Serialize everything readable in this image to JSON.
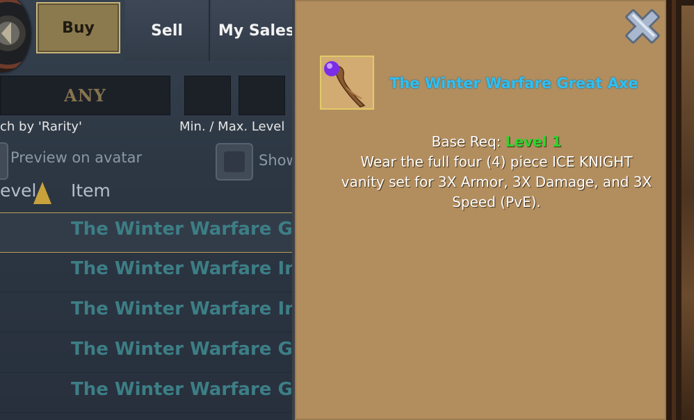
{
  "tabs": [
    {
      "label": "Buy",
      "active": true
    },
    {
      "label": "Sell",
      "active": false
    },
    {
      "label": "My Sales",
      "active": false
    }
  ],
  "filters": {
    "rarity_value": "ANY",
    "rarity_caption": "ch by 'Rarity'",
    "level_caption": "Min. / Max. Level"
  },
  "checkboxes": {
    "preview_label": "Preview on avatar",
    "show_label": "Show"
  },
  "columns": {
    "level": "evel",
    "item": "Item"
  },
  "rows": [
    {
      "name": "The Winter Warfare Great"
    },
    {
      "name": "The Winter Warfare Infan"
    },
    {
      "name": "The Winter Warfare Infan"
    },
    {
      "name": "The Winter Warfare Great"
    },
    {
      "name": "The Winter Warfare Great"
    }
  ],
  "tooltip": {
    "title": "The Winter Warfare Great Axe",
    "base_req_label": "Base Req:",
    "base_req_value": "Level 1",
    "description": "Wear the full four (4) piece ICE KNIGHT vanity set for 3X Armor, 3X Damage, and 3X Speed (PvE).",
    "close_icon": "close-x-icon",
    "item_icon": "staff-with-purple-orb-icon"
  },
  "colors": {
    "tooltip_bg": "#b28e5f",
    "item_title": "#2fbff2",
    "req_value": "#2bd62b",
    "row_text": "#3d7e86",
    "active_tab": "#8b7a4e"
  }
}
